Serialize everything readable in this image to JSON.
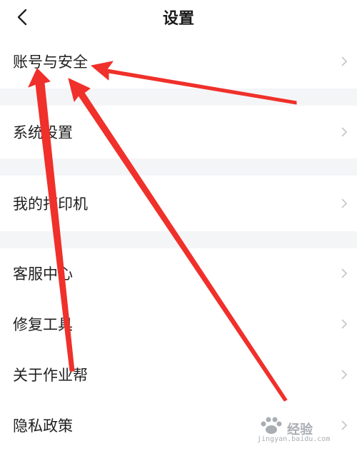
{
  "header": {
    "title": "设置",
    "back_icon": "chevron-left-icon"
  },
  "settings": {
    "items": [
      {
        "label": "账号与安全"
      },
      {
        "label": "系统设置"
      },
      {
        "label": "我的打印机"
      },
      {
        "label": "客服中心"
      },
      {
        "label": "修复工具"
      },
      {
        "label": "关于作业帮"
      },
      {
        "label": "隐私政策"
      }
    ],
    "chevron_icon": "chevron-right-icon"
  },
  "watermark": {
    "text": "经验",
    "url": "jingyan.baidu.com",
    "icon": "paw-icon"
  },
  "colors": {
    "background": "#ffffff",
    "separator": "#f4f5f7",
    "text": "#1f1f1f",
    "chevron": "#c8c8c8",
    "annotation": "#f0302a"
  }
}
